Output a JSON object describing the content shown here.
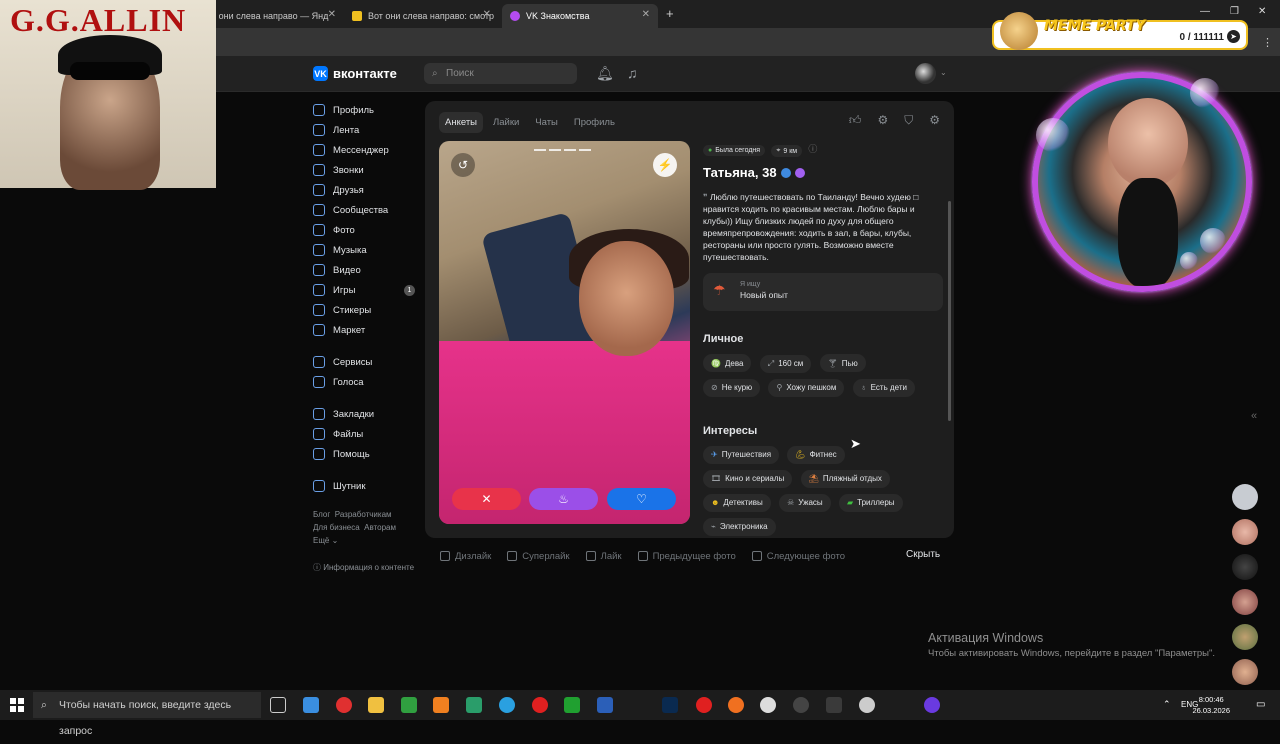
{
  "browser": {
    "tabs": [
      {
        "title": "т они слева направо — Янд",
        "active": false
      },
      {
        "title": "Вот они слева направо: смотр",
        "active": false
      },
      {
        "title": "VK Знакомства",
        "active": true
      }
    ]
  },
  "header": {
    "logo_text": "вконтакте",
    "search_placeholder": "Поиск"
  },
  "sidebar": {
    "items": [
      {
        "label": "Профиль",
        "icon": "user-icon"
      },
      {
        "label": "Лента",
        "icon": "feed-icon"
      },
      {
        "label": "Мессенджер",
        "icon": "message-icon"
      },
      {
        "label": "Звонки",
        "icon": "phone-icon"
      },
      {
        "label": "Друзья",
        "icon": "friends-icon"
      },
      {
        "label": "Сообщества",
        "icon": "communities-icon"
      },
      {
        "label": "Фото",
        "icon": "photo-icon"
      },
      {
        "label": "Музыка",
        "icon": "music-icon"
      },
      {
        "label": "Видео",
        "icon": "video-icon"
      },
      {
        "label": "Игры",
        "icon": "games-icon",
        "badge": "1"
      },
      {
        "label": "Стикеры",
        "icon": "stickers-icon"
      },
      {
        "label": "Маркет",
        "icon": "market-icon"
      }
    ],
    "items2": [
      {
        "label": "Сервисы"
      },
      {
        "label": "Голоса"
      }
    ],
    "items3": [
      {
        "label": "Закладки"
      },
      {
        "label": "Файлы"
      },
      {
        "label": "Помощь"
      }
    ],
    "items4": [
      {
        "label": "Шутник"
      }
    ],
    "footer": {
      "l1a": "Блог",
      "l1b": "Разработчикам",
      "l2a": "Для бизнеса",
      "l2b": "Авторам",
      "l3": "Ещё",
      "info": "Информация о контенте"
    }
  },
  "card": {
    "tabs": [
      "Анкеты",
      "Лайки",
      "Чаты",
      "Профиль"
    ],
    "profile": {
      "status": "Была сегодня",
      "distance": "9 км",
      "name": "Татьяна, 38",
      "about": "Люблю путешествовать по Таиланду! Вечно худею □ нравится ходить по красивым местам. Люблю бары и клубы)) Ищу близких людей по духу для общего времяпрепровождения: ходить в зал, в бары, клубы, рестораны или просто гулять. Возможно вместе путешествовать.",
      "seeking_label": "Я ищу",
      "seeking_value": "Новый опыт"
    },
    "personal_title": "Личное",
    "personal": [
      "Дева",
      "160 см",
      "Пью",
      "Не курю",
      "Хожу пешком",
      "Есть дети"
    ],
    "interests_title": "Интересы",
    "interests": [
      "Путешествия",
      "Фитнес",
      "Кино и сериалы",
      "Пляжный отдых",
      "Детективы",
      "Ужасы",
      "Триллеры",
      "Электроника"
    ]
  },
  "bottombar": {
    "items": [
      "Дизлайк",
      "Суперлайк",
      "Лайк",
      "Предыдущее фото",
      "Следующее фото"
    ],
    "hide": "Скрыть"
  },
  "windows": {
    "activate_title": "Активация Windows",
    "activate_sub": "Чтобы активировать Windows, перейдите в раздел \"Параметры\"."
  },
  "overlay": {
    "gg_title": "G.G.ALLIN",
    "meme_title": "MEME PARTY",
    "meme_count": "0 / 111111"
  },
  "taskbar": {
    "search": "Чтобы начать поиск, введите здесь запрос",
    "lang": "ENG",
    "time": "8:00:46",
    "date": "26.03.2026"
  },
  "colors": {
    "accent": "#0077ff",
    "dislike": "#e8334a",
    "superlike": "#9b4fe8",
    "like": "#1a73e8"
  }
}
